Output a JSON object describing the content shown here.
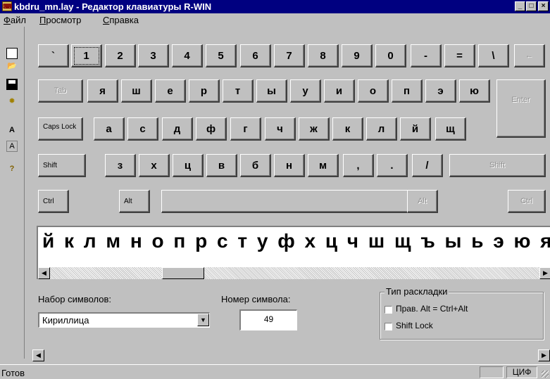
{
  "window": {
    "title": "kbdru_mn.lay - Редактор клавиатуры R-WIN",
    "controls": {
      "minimize": "_",
      "maximize": "□",
      "close": "×"
    }
  },
  "menu": [
    {
      "label": "Файл",
      "hotkey": "Ф",
      "rest": "айл"
    },
    {
      "label": "Просмотр",
      "hotkey": "П",
      "rest": "росмотр"
    },
    {
      "label": "Справка",
      "hotkey": "С",
      "rest": "правка"
    }
  ],
  "toolbar": {
    "icons": [
      "new-file-icon",
      "open-folder-icon",
      "save-disk-icon",
      "lightbulb-icon",
      "font-a-icon",
      "font-a-outline-icon",
      "help-icon"
    ]
  },
  "keyboard": {
    "row1": [
      "`",
      "1",
      "2",
      "3",
      "4",
      "5",
      "6",
      "7",
      "8",
      "9",
      "0",
      "-",
      "=",
      "\\",
      "←"
    ],
    "row2": [
      "Tab",
      "я",
      "ш",
      "е",
      "р",
      "т",
      "ы",
      "у",
      "и",
      "о",
      "п",
      "э",
      "ю",
      "Enter"
    ],
    "row3": [
      "Caps Lock",
      "а",
      "с",
      "д",
      "ф",
      "г",
      "ч",
      "ж",
      "к",
      "л",
      "й",
      "щ"
    ],
    "row4": [
      "Shift",
      "з",
      "х",
      "ц",
      "в",
      "б",
      "н",
      "м",
      ",",
      ".",
      "/",
      "Shift"
    ],
    "row5": [
      "Ctrl",
      "Alt",
      "",
      "Alt",
      "Ctrl"
    ]
  },
  "charstrip": {
    "chars": "й к л м н о п р с т у ф х ц ч ш щ ъ ы ь э ю я"
  },
  "controls": {
    "charset_label": "Набор символов:",
    "charset_value": "Кириллица",
    "charnum_label": "Номер символа:",
    "charnum_value": "49",
    "layout_group": "Тип раскладки",
    "opt_altgr": "Прав. Alt = Ctrl+Alt",
    "opt_shiftlock": "Shift Lock"
  },
  "status": {
    "text": "Готов",
    "panel_num": "ЦИФ"
  }
}
